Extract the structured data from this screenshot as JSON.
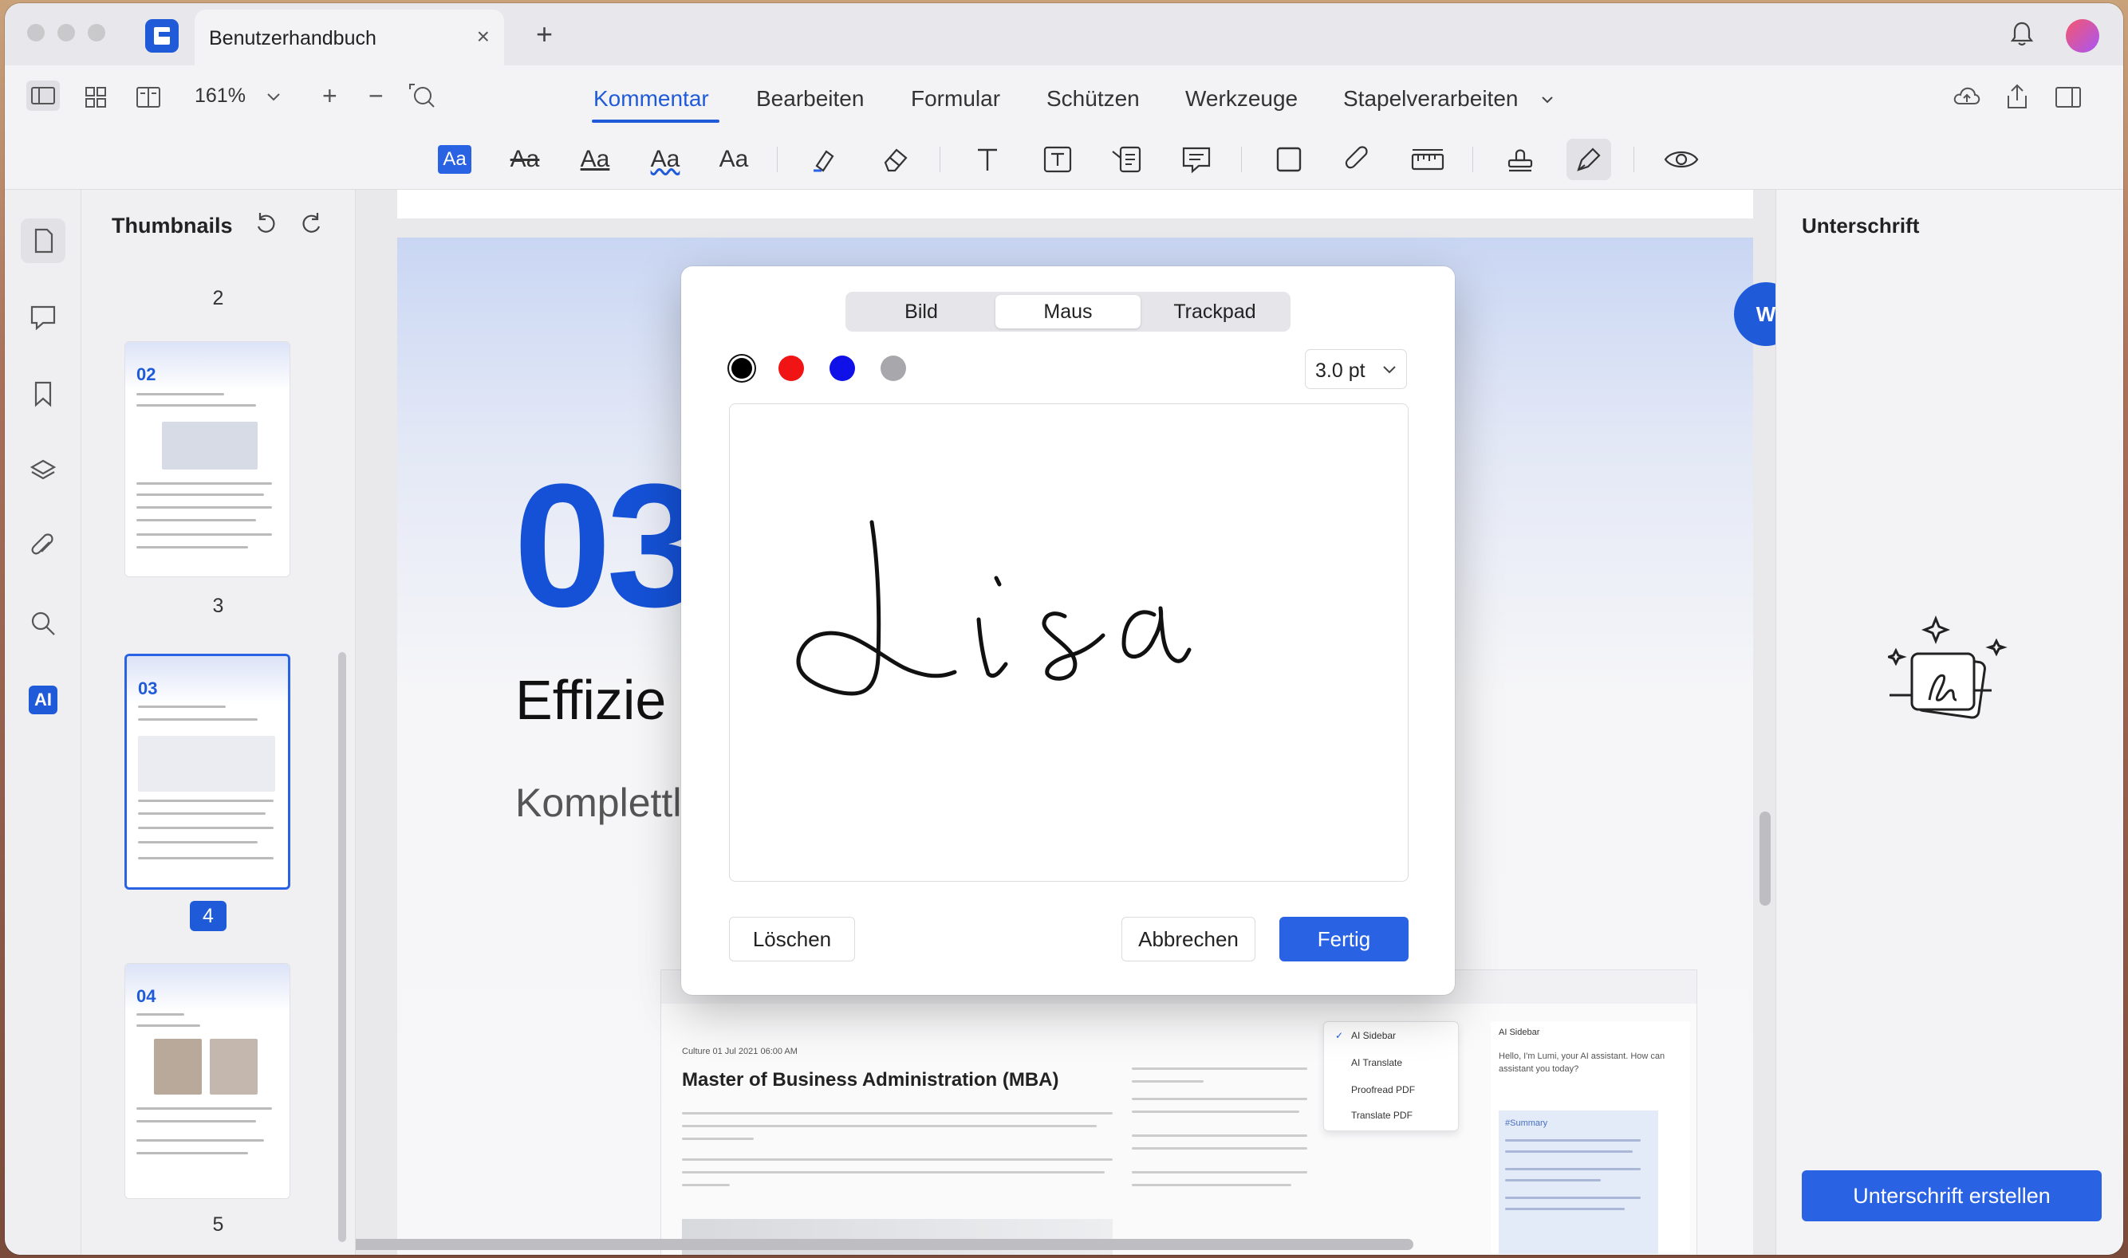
{
  "window": {
    "tab_title": "Benutzerhandbuch",
    "tab_close": "×",
    "tab_add": "+"
  },
  "toolbar": {
    "zoom": "161%",
    "zoom_in": "+",
    "zoom_out": "−",
    "menus": [
      "Kommentar",
      "Bearbeiten",
      "Formular",
      "Schützen",
      "Werkzeuge",
      "Stapelverarbeiten"
    ],
    "active_menu": "Kommentar"
  },
  "annotation_tools": {
    "tool_1": "Aa",
    "tool_2": "Aa",
    "tool_3": "Aa",
    "tool_4": "Aa",
    "tool_5": "Aa"
  },
  "thumbnails": {
    "title": "Thumbnails",
    "pages": [
      {
        "label": "2"
      },
      {
        "num": "02",
        "label": "3"
      },
      {
        "num": "03",
        "label": "4"
      },
      {
        "num": "04",
        "label": "5"
      }
    ]
  },
  "rail": {
    "ai_label": "AI"
  },
  "document": {
    "big_number": "03",
    "heading": "Effizie",
    "subheading": "Komplettl",
    "word_badge": "W",
    "embedded": {
      "date": "Culture 01 Jul 2021 06:00 AM",
      "title": "Master of Business Administration (MBA)",
      "menu_items": [
        "AI Sidebar",
        "AI Translate",
        "Proofread PDF",
        "Translate PDF"
      ],
      "ai_sidebar_title": "AI Sidebar",
      "ai_greeting": "Hello, I'm Lumi, your AI assistant. How can assistant you today?",
      "summary_title": "#Summary"
    }
  },
  "right_panel": {
    "title": "Unterschrift",
    "create_button": "Unterschrift erstellen"
  },
  "modal": {
    "tabs": [
      "Bild",
      "Maus",
      "Trackpad"
    ],
    "selected_tab": "Maus",
    "colors": [
      "#000000",
      "#f01414",
      "#1010e8",
      "#a8a8ac"
    ],
    "selected_color": "#000000",
    "stroke_size": "3.0 pt",
    "signature_text": "Lisa",
    "clear_button": "Löschen",
    "cancel_button": "Abbrechen",
    "done_button": "Fertig"
  }
}
